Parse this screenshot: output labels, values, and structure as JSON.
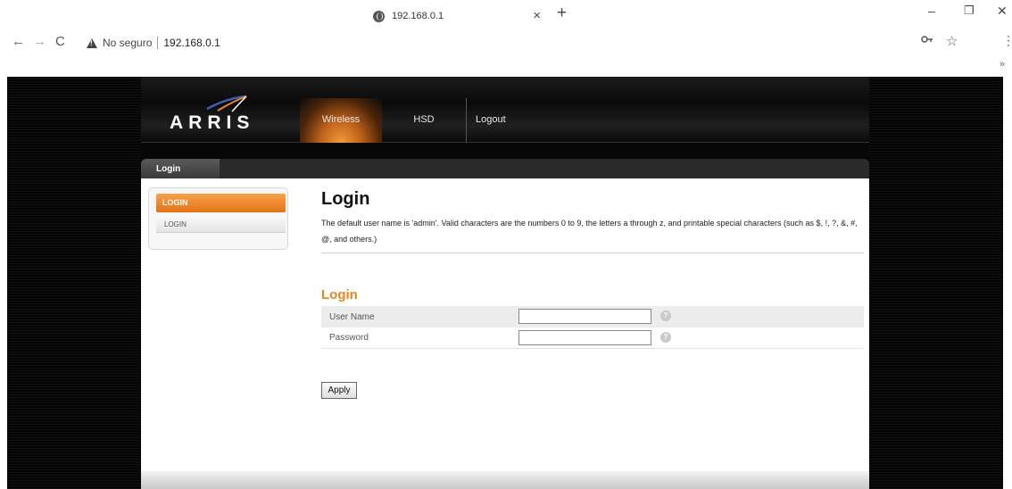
{
  "browser": {
    "tab_title": "192.168.0.1",
    "tab_close": "×",
    "new_tab": "+",
    "minimize": "–",
    "restore": "❐",
    "close_window": "✕",
    "back": "←",
    "forward": "→",
    "reload": "C",
    "security_label": "No seguro",
    "url": "192.168.0.1",
    "bookmarks_overflow": "»"
  },
  "header": {
    "logo_text": "ARRIS",
    "nav": [
      "Wireless",
      "HSD",
      "Logout"
    ],
    "active_nav": "Wireless"
  },
  "tabs": {
    "active": "Login"
  },
  "sidebar": {
    "active_item": "LOGIN",
    "sub_item": "LOGIN"
  },
  "main": {
    "title": "Login",
    "description": "The default user name is 'admin'. Valid characters are the numbers 0 to 9, the letters a through z, and printable special characters (such as $, !, ?, &, #, @, and others.)",
    "section_title": "Login",
    "fields": [
      {
        "label": "User Name",
        "value": "",
        "help": "?"
      },
      {
        "label": "Password",
        "value": "",
        "help": "?"
      }
    ],
    "apply_label": "Apply"
  },
  "colors": {
    "accent_orange": "#e8851f",
    "header_bg": "#0a0a0a"
  }
}
